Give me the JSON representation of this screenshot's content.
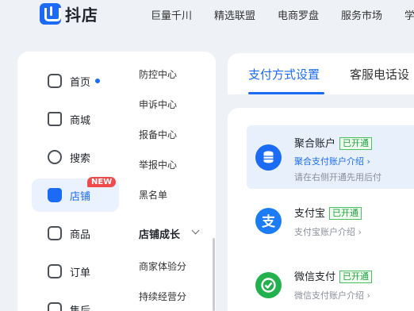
{
  "brand": {
    "name": "抖店",
    "accent": "#1c6bf5"
  },
  "topnav": [
    {
      "label": "巨量千川"
    },
    {
      "label": "精选联盟"
    },
    {
      "label": "电商罗盘"
    },
    {
      "label": "服务市场"
    },
    {
      "label": "学"
    }
  ],
  "sidebar": {
    "items": [
      {
        "label": "首页",
        "icon": "home-icon"
      },
      {
        "label": "商城",
        "icon": "mall-icon"
      },
      {
        "label": "搜索",
        "icon": "search-icon"
      },
      {
        "label": "店铺",
        "icon": "store-icon",
        "badge": "NEW"
      },
      {
        "label": "商品",
        "icon": "goods-icon"
      },
      {
        "label": "订单",
        "icon": "order-icon"
      },
      {
        "label": "售后",
        "icon": "aftersale-icon"
      }
    ],
    "submenu": [
      {
        "label": "防控中心"
      },
      {
        "label": "申诉中心"
      },
      {
        "label": "报备中心"
      },
      {
        "label": "举报中心"
      },
      {
        "label": "黑名单"
      }
    ],
    "group": {
      "title": "店铺成长",
      "items": [
        {
          "label": "商家体验分"
        },
        {
          "label": "持续经营分"
        }
      ]
    }
  },
  "tabs": [
    {
      "label": "支付方式设置"
    },
    {
      "label": "客服电话设"
    }
  ],
  "payments": [
    {
      "name": "聚合账户",
      "status": "已开通",
      "link": "聚合支付账户介绍 ›",
      "sub": "请在右侧开通先用后付",
      "icon": "aggregate-account-icon",
      "color": "#1c6bf5"
    },
    {
      "name": "支付宝",
      "status": "已开通",
      "link": "支付宝账户介绍 ›",
      "icon": "alipay-icon",
      "color": "#1c7cf5"
    },
    {
      "name": "微信支付",
      "status": "已开通",
      "link": "微信支付账户介绍 ›",
      "icon": "wechat-pay-icon",
      "color": "#22b14c"
    }
  ]
}
